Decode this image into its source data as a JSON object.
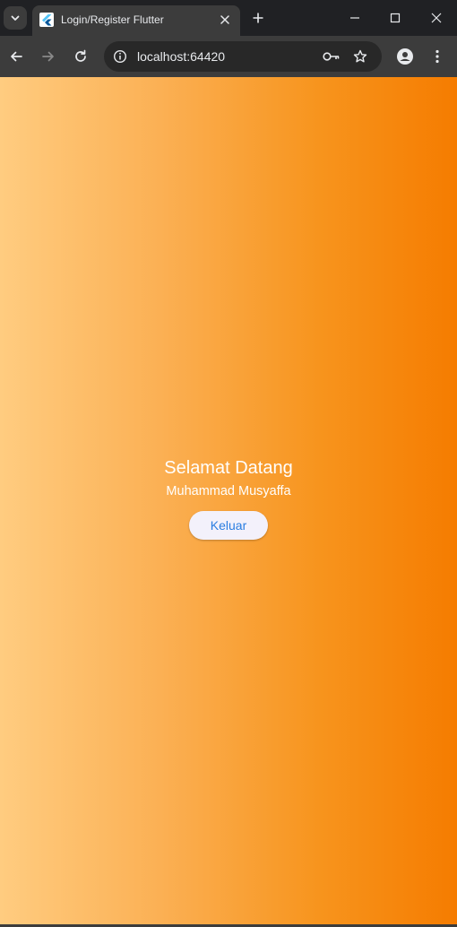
{
  "browser": {
    "tab": {
      "title": "Login/Register Flutter",
      "favicon": "flutter-icon"
    },
    "address_bar": {
      "url": "localhost:64420"
    },
    "icons": {
      "tab_search": "chevron-down-icon",
      "tab_close": "close-icon",
      "new_tab": "plus-icon",
      "minimize": "minimize-icon",
      "maximize": "maximize-icon",
      "close_window": "close-icon",
      "back": "arrow-left-icon",
      "forward": "arrow-right-icon",
      "reload": "reload-icon",
      "site_info": "info-icon",
      "password_key": "key-icon",
      "bookmark": "star-icon",
      "profile": "profile-icon",
      "menu": "kebab-menu-icon"
    }
  },
  "page": {
    "welcome_text": "Selamat Datang",
    "user_name": "Muhammad Musyaffa",
    "logout_label": "Keluar"
  },
  "colors": {
    "gradient_start": "#ffcc80",
    "gradient_end": "#f57c00",
    "button_bg": "#f3f1fb",
    "button_text": "#2a7de1"
  }
}
